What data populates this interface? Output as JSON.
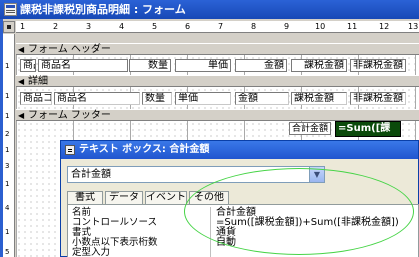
{
  "window": {
    "title": "課税非課税別商品明細 : フォーム"
  },
  "ruler": {
    "marks": [
      "1",
      "2",
      "3",
      "4",
      "5",
      "6",
      "7",
      "8",
      "9",
      "10",
      "11",
      "12",
      "13"
    ],
    "vertical_marks": [
      "1",
      "1",
      "1",
      "2",
      "1",
      "3",
      "1",
      "4",
      "1",
      "5"
    ]
  },
  "sections": {
    "header": "フォーム ヘッダー",
    "detail": "詳細",
    "footer": "フォーム フッター"
  },
  "header_labels": [
    "商品",
    "商品名",
    "数量",
    "単価",
    "金額",
    "課税金額",
    "非課税金額"
  ],
  "detail_fields": [
    "商品コ",
    "商品名",
    "数量",
    "単価",
    "金額",
    "課税金額",
    "非課税金額"
  ],
  "footer_controls": {
    "label": "合計金額",
    "textbox": "=Sum([課"
  },
  "property_sheet": {
    "title": "テキスト ボックス: 合計金額",
    "object_selector": "合計金額",
    "tabs": [
      "書式",
      "データ",
      "イベント",
      "その他"
    ],
    "properties": [
      {
        "name": "名前",
        "value": "合計金額"
      },
      {
        "name": "コントロールソース",
        "value": "=Sum([課税金額])+Sum([非課税金額])"
      },
      {
        "name": "書式",
        "value": "通貨"
      },
      {
        "name": "小数点以下表示桁数",
        "value": "自動"
      },
      {
        "name": "定型入力",
        "value": ""
      }
    ]
  },
  "colors": {
    "title_bar": "#1f52c4",
    "selected_control": "#0b4a0b",
    "callout": "#48d448"
  }
}
